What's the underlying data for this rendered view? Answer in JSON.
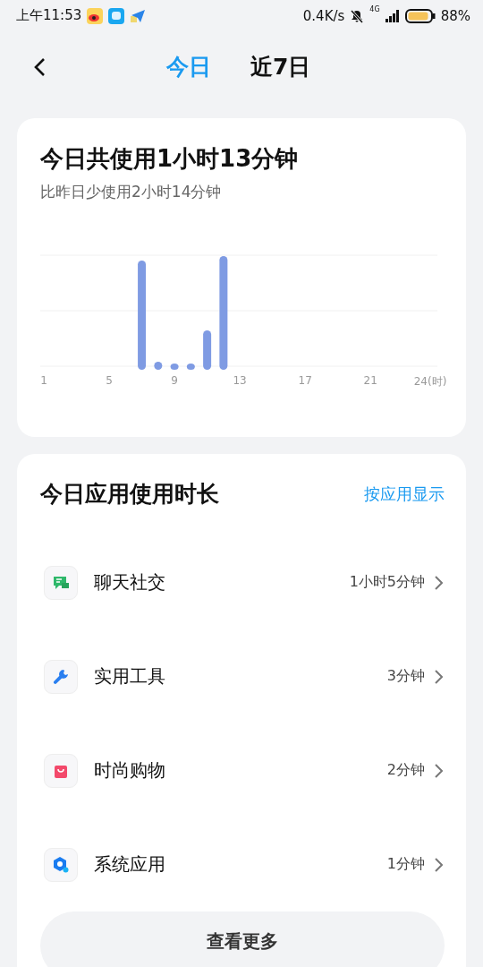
{
  "status_bar": {
    "time": "上午11:53",
    "speed": "0.4K/s",
    "network": "4G",
    "battery": "88%"
  },
  "header": {
    "tabs": [
      {
        "label": "今日",
        "selected": true
      },
      {
        "label": "近7日",
        "selected": false
      }
    ]
  },
  "summary": {
    "title": "今日共使用1小时13分钟",
    "subtitle": "比昨日少使用2小时14分钟",
    "axis_labels": [
      "1",
      "5",
      "9",
      "13",
      "17",
      "21",
      "24(时)"
    ]
  },
  "apps_card": {
    "title": "今日应用使用时长",
    "toggle": "按应用显示",
    "rows": [
      {
        "kind": "chat",
        "name": "聊天社交",
        "duration": "1小时5分钟"
      },
      {
        "kind": "tool",
        "name": "实用工具",
        "duration": "3分钟"
      },
      {
        "kind": "shop",
        "name": "时尚购物",
        "duration": "2分钟"
      },
      {
        "kind": "system",
        "name": "系统应用",
        "duration": "1分钟"
      }
    ],
    "more": "查看更多"
  }
}
